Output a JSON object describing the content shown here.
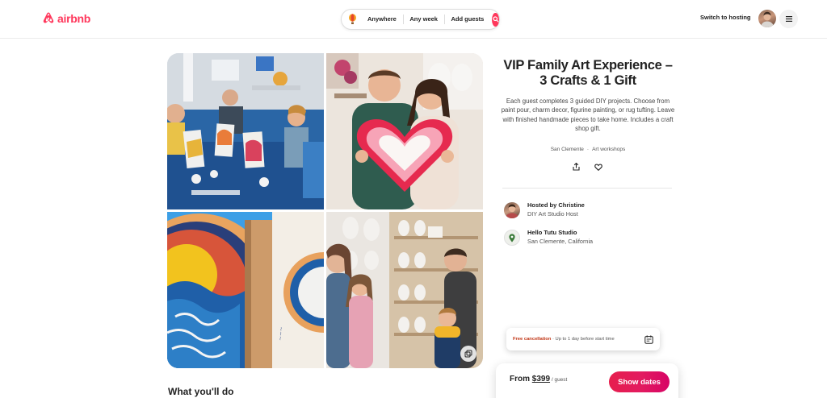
{
  "header": {
    "logo_text": "airbnb",
    "search": {
      "location": "Anywhere",
      "dates": "Any week",
      "guests": "Add guests"
    },
    "switch_to_hosting": "Switch to hosting"
  },
  "listing": {
    "title": "VIP Family Art Experience – 3 Crafts & 1 Gift",
    "description": "Each guest completes 3 guided DIY projects. Choose from paint pour, charm decor, figurine painting, or rug tufting. Leave with finished handmade pieces to take home. Includes a craft shop gift.",
    "location": "San Clemente",
    "separator": "·",
    "category": "Art workshops"
  },
  "host": {
    "title": "Hosted by Christine",
    "subtitle": "DIY Art Studio Host"
  },
  "venue": {
    "title": "Hello Tutu Studio",
    "subtitle": "San Clemente, California"
  },
  "cancellation": {
    "lead": "Free cancellation",
    "detail": " · Up to 1 day before start time"
  },
  "booking": {
    "from": "From ",
    "price": "$399",
    "per": " / guest",
    "button": "Show dates"
  },
  "section": {
    "what_youll_do": "What you'll do"
  },
  "icons": {
    "logo": "airbnb-logo-icon",
    "search_balloon": "balloon-icon",
    "search_button": "search-icon",
    "menu": "hamburger-menu-icon",
    "share": "share-icon",
    "save": "heart-icon",
    "venue": "map-pin-icon",
    "calendar": "calendar-icon",
    "gallery": "gallery-icon"
  },
  "colors": {
    "brand": "#ff385c",
    "button_gradient_start": "#e61e4d",
    "button_gradient_end": "#d70466",
    "cancellation_accent": "#c13515"
  }
}
